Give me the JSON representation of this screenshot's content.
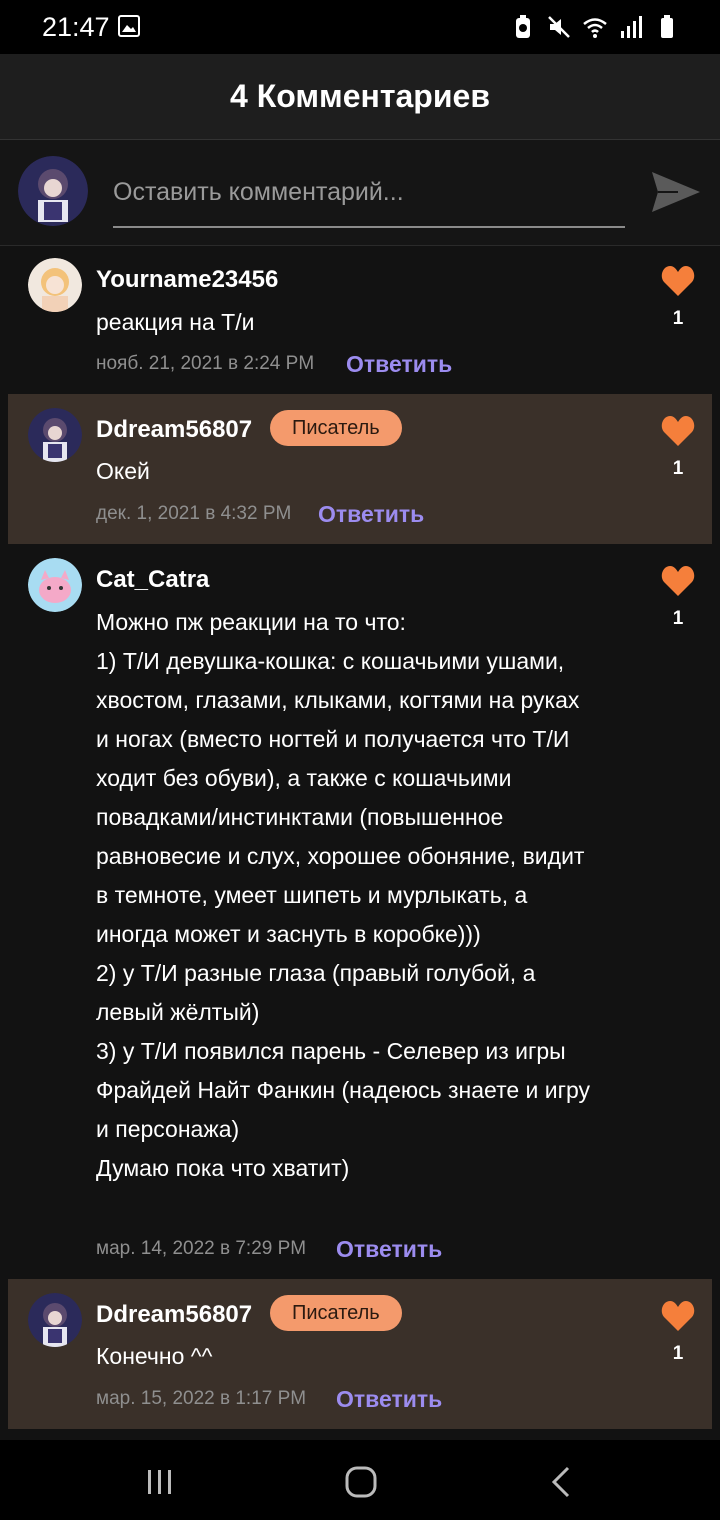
{
  "status_bar": {
    "time": "21:47",
    "icons": [
      "gallery-icon",
      "battery-saver-icon",
      "mute-icon",
      "wifi-icon",
      "signal-icon",
      "battery-icon"
    ]
  },
  "header": {
    "title": "4 Комментариев"
  },
  "composer": {
    "placeholder": "Оставить комментарий...",
    "send_icon": "send-icon"
  },
  "colors": {
    "background": "#121212",
    "header": "#1e1e1e",
    "writer_highlight": "#3a3029",
    "badge": "#f49a6c",
    "reply": "#9c8cef",
    "heart": "#f57f3b"
  },
  "comments": [
    {
      "username": "Yourname23456",
      "badge": "",
      "text": "реакция на Т/и",
      "date": "нояб. 21, 2021 в 2:24 PM",
      "reply_label": "Ответить",
      "likes": "1"
    },
    {
      "username": "Ddream56807",
      "badge": "Писатель",
      "text": "Окей",
      "date": "дек. 1, 2021 в 4:32 PM",
      "reply_label": "Ответить",
      "likes": "1"
    },
    {
      "username": "Cat_Catra",
      "badge": "",
      "text": "Можно пж реакции на то что:\n1) Т/И девушка-кошка: с кошачьими ушами, хвостом, глазами, клыками, когтями на руках и ногах (вместо ногтей и получается что Т/И ходит без обуви), а также с кошачьими повадками/инстинктами (повышенное равновесие и слух, хорошее обоняние, видит в темноте, умеет шипеть и мурлыкать, а иногда может и заснуть в коробке)))\n2) у Т/И разные глаза (правый голубой, а левый жёлтый)\n3) у Т/И появился парень - Селевер из игры Фрайдей Найт Фанкин (надеюсь знаете и игру и персонажа)\nДумаю пока что хватит)",
      "date": "мар. 14, 2022 в 7:29 PM",
      "reply_label": "Ответить",
      "likes": "1"
    },
    {
      "username": "Ddream56807",
      "badge": "Писатель",
      "text": "Конечно ^^",
      "date": "мар. 15, 2022 в 1:17 PM",
      "reply_label": "Ответить",
      "likes": "1"
    }
  ],
  "nav_bar": {
    "icons": [
      "recent-apps-icon",
      "home-icon",
      "back-icon"
    ]
  }
}
